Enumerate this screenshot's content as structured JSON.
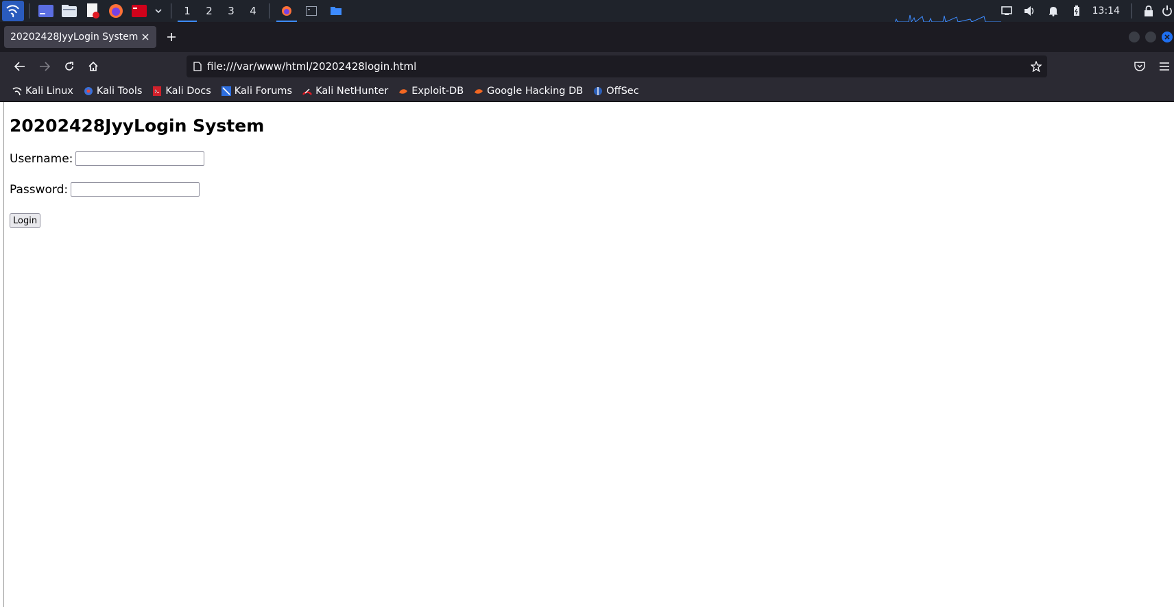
{
  "panel": {
    "workspaces": [
      "1",
      "2",
      "3",
      "4"
    ],
    "active_workspace": "1",
    "clock": "13:14",
    "launchers": [
      "terminal-icon",
      "file-manager-icon",
      "text-editor-icon",
      "firefox-icon",
      "terminal-root-icon"
    ],
    "tray": [
      "network-icon",
      "volume-icon",
      "bell-icon",
      "battery-icon",
      "lock-icon"
    ]
  },
  "browser": {
    "tab_title": "20202428JyyLogin System",
    "url": "file:///var/www/html/20202428login.html",
    "bookmarks": [
      {
        "label": "Kali Linux",
        "icon": "kali-dragon-icon"
      },
      {
        "label": "Kali Tools",
        "icon": "kali-tools-icon"
      },
      {
        "label": "Kali Docs",
        "icon": "kali-docs-icon"
      },
      {
        "label": "Kali Forums",
        "icon": "kali-forums-icon"
      },
      {
        "label": "Kali NetHunter",
        "icon": "nethunter-icon"
      },
      {
        "label": "Exploit-DB",
        "icon": "exploit-db-icon"
      },
      {
        "label": "Google Hacking DB",
        "icon": "ghdb-icon"
      },
      {
        "label": "OffSec",
        "icon": "offsec-icon"
      }
    ]
  },
  "page": {
    "heading": "20202428JyyLogin System",
    "username_label": "Username:",
    "username_value": "",
    "password_label": "Password:",
    "password_value": "",
    "login_label": "Login"
  },
  "colors": {
    "panel_bg": "#1f232b",
    "accent": "#3d8bff",
    "tabstrip_bg": "#1c1b22",
    "toolbar_bg": "#2b2a33"
  }
}
